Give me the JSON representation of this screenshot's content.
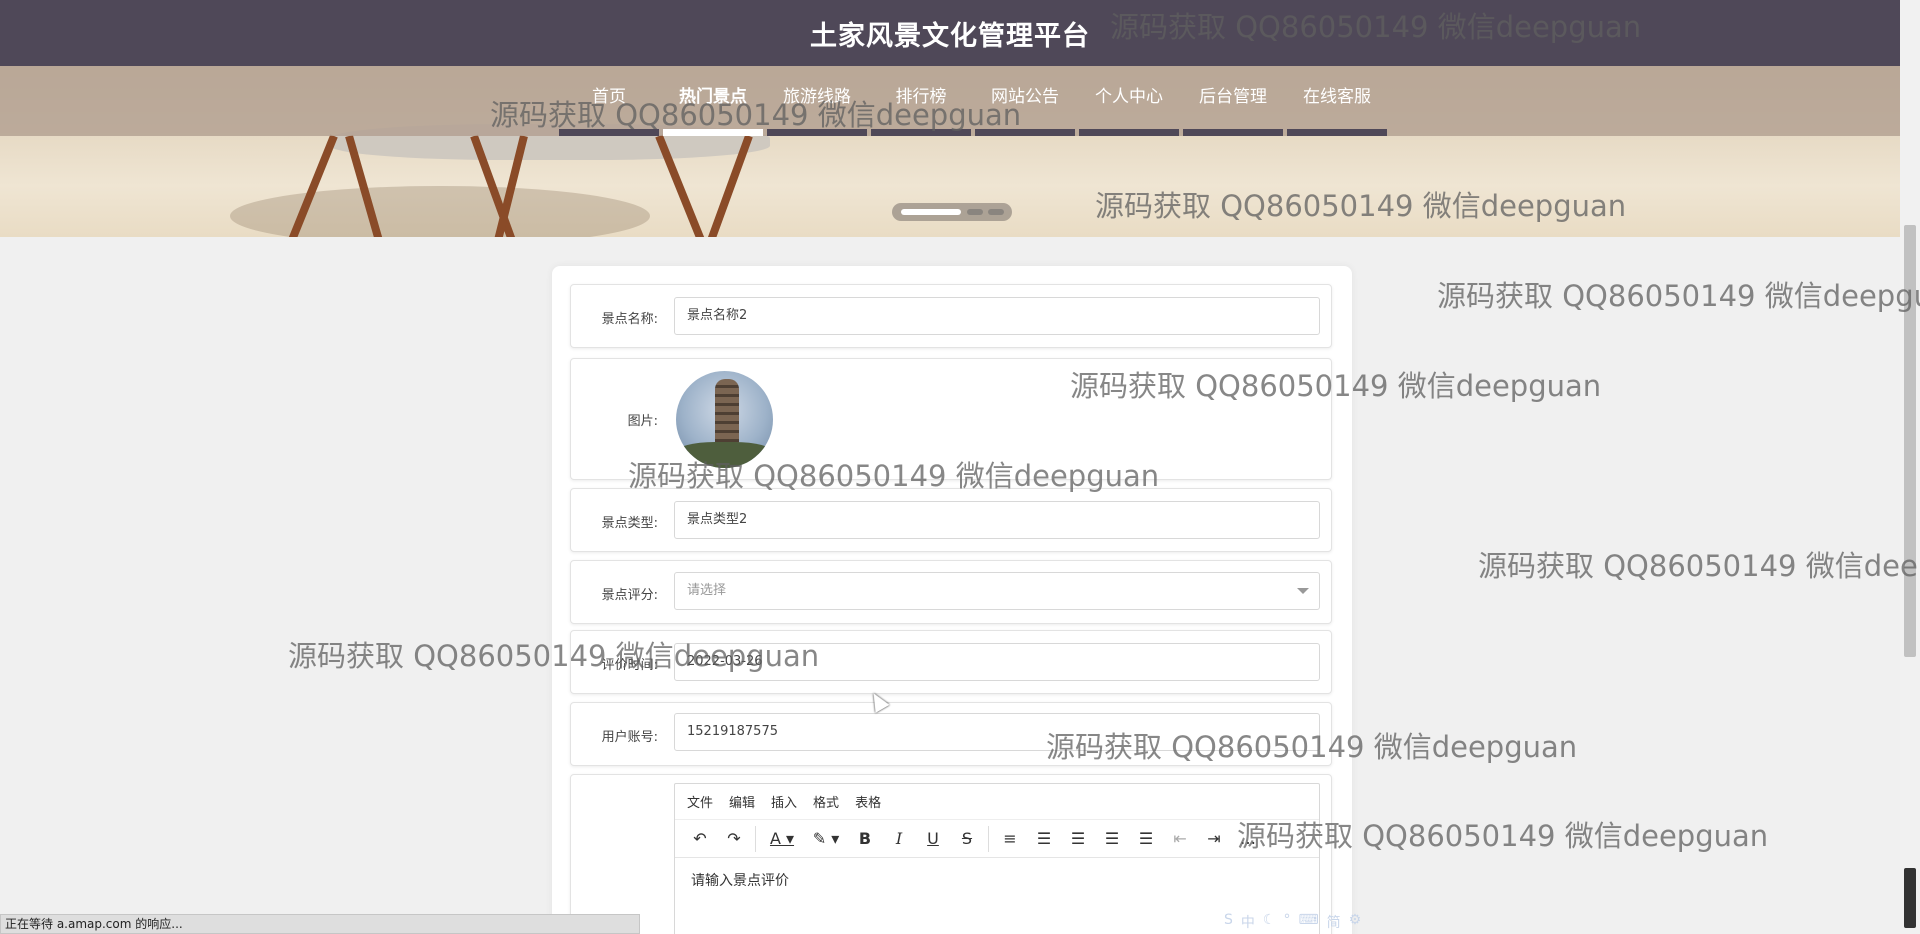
{
  "site": {
    "title": "土家风景文化管理平台"
  },
  "nav": {
    "items": [
      {
        "label": "首页"
      },
      {
        "label": "热门景点"
      },
      {
        "label": "旅游线路"
      },
      {
        "label": "排行榜"
      },
      {
        "label": "网站公告"
      },
      {
        "label": "个人中心"
      },
      {
        "label": "后台管理"
      },
      {
        "label": "在线客服"
      }
    ],
    "active": "热门景点"
  },
  "form": {
    "name_label": "景点名称:",
    "name_value": "景点名称2",
    "image_label": "图片:",
    "type_label": "景点类型:",
    "type_value": "景点类型2",
    "rating_label": "景点评分:",
    "rating_placeholder": "请选择",
    "time_label": "评价时间:",
    "time_value": "2022-03-26",
    "account_label": "用户账号:",
    "account_value": "15219187575"
  },
  "editor": {
    "menu": [
      "文件",
      "编辑",
      "插入",
      "格式",
      "表格"
    ],
    "toolbar_icons": [
      "undo-icon",
      "redo-icon",
      "font-color-icon",
      "highlight-icon",
      "bold-icon",
      "italic-icon",
      "underline-icon",
      "strikethrough-icon",
      "line-height-icon",
      "align-left-icon",
      "align-center-icon",
      "align-right-icon",
      "align-justify-icon",
      "outdent-icon",
      "indent-icon",
      "more-icon"
    ],
    "content": "请输入景点评价"
  },
  "watermark": "源码获取 QQ86050149 微信deepguan",
  "status": {
    "text": "正在等待 a.amap.com 的响应..."
  }
}
